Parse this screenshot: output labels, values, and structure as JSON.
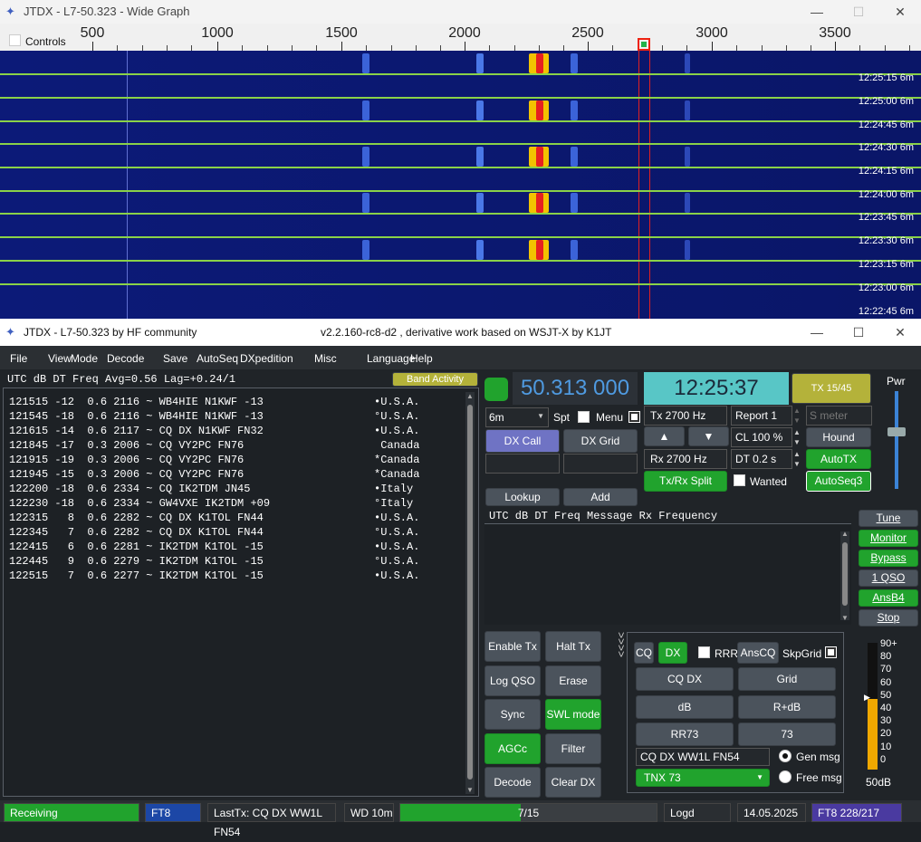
{
  "wide_graph": {
    "title": "JTDX - L7-50.323 - Wide Graph",
    "controls_label": "Controls",
    "scale_ticks": [
      "500",
      "1000",
      "1500",
      "2000",
      "2500",
      "3000",
      "3500"
    ],
    "timestamps": [
      {
        "time": "12:25:15",
        "band": "6m"
      },
      {
        "time": "12:25:00",
        "band": "6m"
      },
      {
        "time": "12:24:45",
        "band": "6m"
      },
      {
        "time": "12:24:30",
        "band": "6m"
      },
      {
        "time": "12:24:15",
        "band": "6m"
      },
      {
        "time": "12:24:00",
        "band": "6m"
      },
      {
        "time": "12:23:45",
        "band": "6m"
      },
      {
        "time": "12:23:30",
        "band": "6m"
      },
      {
        "time": "12:23:15",
        "band": "6m"
      },
      {
        "time": "12:23:00",
        "band": "6m"
      },
      {
        "time": "12:22:45",
        "band": "6m"
      }
    ],
    "win_min": "—",
    "win_max": "☐",
    "win_close": "✕"
  },
  "main": {
    "title_left": "JTDX - L7-50.323  by HF community",
    "title_center": "v2.2.160-rc8-d2 , derivative work based on WSJT-X by K1JT",
    "menu": [
      "File",
      "View",
      "Mode",
      "Decode",
      "Save",
      "AutoSeq",
      "DXpedition",
      "Misc",
      "Language",
      "Help"
    ],
    "header": "UTC      dB   DT Freq    Avg=0.56 Lag=+0.24/1",
    "band_activity": "Band Activity",
    "decodes": [
      {
        "t": "121515 -12  0.6 2116 ~ WB4HIE N1KWF -13",
        "c": "•U.S.A."
      },
      {
        "t": "121545 -18  0.6 2116 ~ WB4HIE N1KWF -13",
        "c": "°U.S.A."
      },
      {
        "t": "121615 -14  0.6 2117 ~ CQ DX N1KWF FN32",
        "c": "•U.S.A."
      },
      {
        "t": "121845 -17  0.3 2006 ~ CQ VY2PC FN76",
        "c": " Canada"
      },
      {
        "t": "121915 -19  0.3 2006 ~ CQ VY2PC FN76",
        "c": "*Canada"
      },
      {
        "t": "121945 -15  0.3 2006 ~ CQ VY2PC FN76",
        "c": "*Canada"
      },
      {
        "t": "122200 -18  0.6 2334 ~ CQ IK2TDM JN45",
        "c": "•Italy"
      },
      {
        "t": "122230 -18  0.6 2334 ~ GW4VXE IK2TDM +09",
        "c": "°Italy"
      },
      {
        "t": "122315   8  0.6 2282 ~ CQ DX K1TOL FN44",
        "c": "•U.S.A."
      },
      {
        "t": "122345   7  0.6 2282 ~ CQ DX K1TOL FN44",
        "c": "°U.S.A."
      },
      {
        "t": "122415   6  0.6 2281 ~ IK2TDM K1TOL -15",
        "c": "•U.S.A."
      },
      {
        "t": "122445   9  0.6 2279 ~ IK2TDM K1TOL -15",
        "c": "°U.S.A."
      },
      {
        "t": "122515   7  0.6 2277 ~ IK2TDM K1TOL -15",
        "c": "•U.S.A."
      }
    ],
    "freq": "50.313 000",
    "clock": "12:25:37",
    "tx_period": "TX 15/45",
    "pwr": "Pwr",
    "band": "6m",
    "spt": "Spt",
    "menu_lbl": "Menu",
    "dx_call": "DX Call",
    "dx_grid": "DX Grid",
    "lookup": "Lookup",
    "add": "Add",
    "tx_hz": "Tx  2700  Hz",
    "rx_hz": "Rx  2700  Hz",
    "report": "Report  1",
    "s_meter": "S meter",
    "cl": "CL   100  %",
    "dt": "DT  0.2 s",
    "hound": "Hound",
    "autotx": "AutoTX",
    "txrx_split": "Tx/Rx Split",
    "wanted": "Wanted",
    "autoseq3": "AutoSeq3",
    "rx_header": "UTC       dB   DT Freq    Message            Rx Frequency",
    "side": [
      "Tune",
      "Monitor",
      "Bypass",
      "1 QSO",
      "AnsB4",
      "Stop"
    ],
    "left_btns": [
      "Enable Tx",
      "Halt Tx",
      "Log QSO",
      "Erase",
      "Sync",
      "SWL mode",
      "AGCc",
      "Filter",
      "Decode",
      "Clear DX"
    ],
    "cq": "CQ",
    "dx": "DX",
    "rrr": "RRR",
    "anscq": "AnsCQ",
    "skpgrid": "SkpGrid",
    "msg_btns": [
      "CQ DX",
      "Grid",
      "dB",
      "R+dB",
      "RR73",
      "73"
    ],
    "msg_text": "CQ DX WW1L FN54",
    "gen_msg": "Gen msg",
    "tnx": "TNX 73",
    "free_msg": "Free msg",
    "meter_labels": [
      "90+",
      "80",
      "70",
      "60",
      "50",
      "40",
      "30",
      "20",
      "10",
      "0"
    ],
    "meter_db": "50dB",
    "status": {
      "state": "Receiving",
      "mode": "FT8",
      "last_tx": "LastTx: CQ DX WW1L FN54",
      "wd": "WD 10m",
      "progress": "7/15",
      "progress_fraction": 0.47,
      "logd": "Logd",
      "date": "14.05.2025",
      "ft8": "FT8  228/217"
    },
    "win_min": "—",
    "win_max": "☐",
    "win_close": "✕"
  }
}
